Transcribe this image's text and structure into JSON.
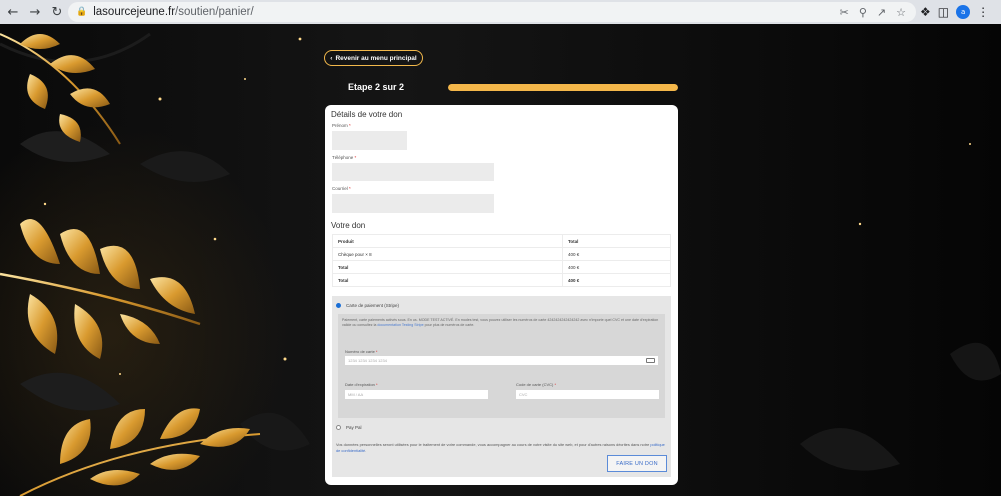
{
  "browser": {
    "url_host": "lasourcejeune.fr",
    "url_path": "/soutien/panier/",
    "profile_initial": "a"
  },
  "page": {
    "back_button": "Revenir au menu principal",
    "step_label": "Etape 2 sur 2",
    "progress": 1.0
  },
  "details": {
    "heading": "Détails de votre don",
    "fields": [
      {
        "label": "Prénom",
        "required": "*"
      },
      {
        "label": "Téléphone",
        "required": "*"
      },
      {
        "label": "Courriel",
        "required": "*"
      }
    ]
  },
  "order": {
    "heading": "Votre don",
    "columns": [
      "Produit",
      "Total"
    ],
    "rows": [
      {
        "product": "Chèque pour × 8",
        "total": "400 €"
      },
      {
        "product": "Total",
        "total": "400 €"
      },
      {
        "product": "Total",
        "total": "400 €"
      }
    ]
  },
  "payment": {
    "option_card": "Carte de paiement (Stripe)",
    "test_info_text": "Paiement, carte paiements activés sous. En us. MODE TEST ACTIVÉ. En modes test, vous pouvez utiliser les numéros de carte 4242424242424242 avec n'importe quel CVC et une date d'expiration valide ou consultez la",
    "test_info_link": "documentation Testing Stripe",
    "test_info_after": "pour plus de numéros de carte.",
    "card_number_label": "Numéro de carte",
    "card_number_placeholder": "1234 1234 1234 1234",
    "expiry_label": "Date d'expiration",
    "expiry_placeholder": "MM / AA",
    "cvc_label": "Code de carte (CVC)",
    "cvc_placeholder": "CVC",
    "required": "*",
    "option_other": "Pay Pal",
    "privacy_text": "Vos données personnelles seront utilisées pour le traitement de votre commande, vous accompagner au cours de votre visite du site web, et pour d'autres raisons décrites dans notre",
    "privacy_link": "politique de confidentialité",
    "privacy_end": ".",
    "submit_label": "FAIRE UN DON"
  },
  "colors": {
    "accent": "#f4b74a",
    "link": "#3a6cc8",
    "radio_selected": "#1a6fd6"
  }
}
